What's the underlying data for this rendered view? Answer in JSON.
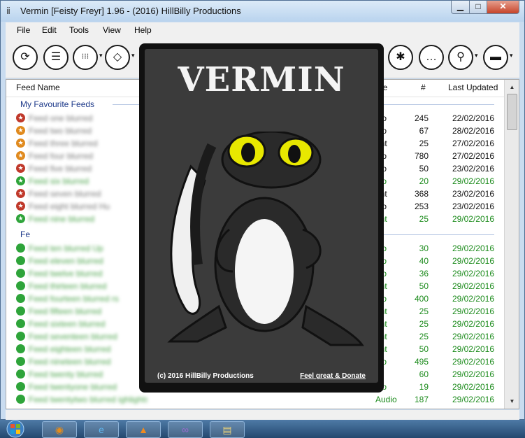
{
  "window": {
    "title": "Vermin [Feisty Freyr] 1.96 - (2016) HillBilly Productions",
    "icon": "app-icon",
    "min_glyph": "▁",
    "max_glyph": "□",
    "close_glyph": "✕"
  },
  "menu": [
    "File",
    "Edit",
    "Tools",
    "View",
    "Help"
  ],
  "toolbar": {
    "buttons": [
      {
        "name": "refresh-icon",
        "glyph": "⟳"
      },
      {
        "name": "database-icon",
        "glyph": "☰"
      },
      {
        "name": "grid-icon",
        "glyph": "⁝⁝⁝"
      },
      {
        "name": "drop-icon",
        "glyph": "◇"
      },
      {
        "name": "gear-icon",
        "glyph": "✱"
      },
      {
        "name": "chat-icon",
        "glyph": "…"
      },
      {
        "name": "search-icon",
        "glyph": "⚲"
      },
      {
        "name": "book-icon",
        "glyph": "▬"
      }
    ],
    "dropdown_glyph": "▾"
  },
  "columns": {
    "feed_name": "Feed Name",
    "type": "pe",
    "count": "#",
    "last_updated": "Last Updated"
  },
  "groups": {
    "favourites": "My Favourite Feeds",
    "second": "Fe"
  },
  "favourites_rows": [
    {
      "name": "Feed one blurred",
      "type": "dio",
      "count": "245",
      "date": "22/02/2016",
      "icon": "red",
      "green": false
    },
    {
      "name": "Feed two blurred",
      "type": "dio",
      "count": "67",
      "date": "28/02/2016",
      "icon": "orange",
      "green": false
    },
    {
      "name": "Feed three blurred",
      "type": "ent",
      "count": "25",
      "date": "27/02/2016",
      "icon": "orange",
      "green": false
    },
    {
      "name": "Feed four blurred",
      "type": "dio",
      "count": "780",
      "date": "27/02/2016",
      "icon": "orange",
      "green": false
    },
    {
      "name": "Feed five blurred",
      "type": "dio",
      "count": "50",
      "date": "23/02/2016",
      "icon": "red",
      "green": false
    },
    {
      "name": "Feed six blurred",
      "type": "dio",
      "count": "20",
      "date": "29/02/2016",
      "icon": "green",
      "green": true
    },
    {
      "name": "Feed seven blurred",
      "type": "ent",
      "count": "368",
      "date": "23/02/2016",
      "icon": "red",
      "green": false
    },
    {
      "name": "Feed eight blurred Hu",
      "type": "dio",
      "count": "253",
      "date": "23/02/2016",
      "icon": "red",
      "green": false
    },
    {
      "name": "Feed nine blurred",
      "type": "ent",
      "count": "25",
      "date": "29/02/2016",
      "icon": "green",
      "green": true
    }
  ],
  "other_rows": [
    {
      "name": "Feed ten blurred Up",
      "type": "dio",
      "count": "30",
      "date": "29/02/2016"
    },
    {
      "name": "Feed eleven blurred",
      "type": "dio",
      "count": "40",
      "date": "29/02/2016"
    },
    {
      "name": "Feed twelve blurred",
      "type": "dio",
      "count": "36",
      "date": "29/02/2016"
    },
    {
      "name": "Feed thirteen blurred",
      "type": "ent",
      "count": "50",
      "date": "29/02/2016"
    },
    {
      "name": "Feed fourteen blurred rs",
      "type": "dio",
      "count": "400",
      "date": "29/02/2016"
    },
    {
      "name": "Feed fifteen blurred",
      "type": "ent",
      "count": "25",
      "date": "29/02/2016"
    },
    {
      "name": "Feed sixteen blurred",
      "type": "ent",
      "count": "25",
      "date": "29/02/2016"
    },
    {
      "name": "Feed seventeen blurred",
      "type": "ent",
      "count": "25",
      "date": "29/02/2016"
    },
    {
      "name": "Feed eighteen blurred",
      "type": "ent",
      "count": "50",
      "date": "29/02/2016"
    },
    {
      "name": "Feed nineteen blurred",
      "type": "dio",
      "count": "495",
      "date": "29/02/2016"
    },
    {
      "name": "Feed twenty blurred",
      "type": "et",
      "count": "60",
      "date": "29/02/2016"
    },
    {
      "name": "Feed twentyone blurred",
      "type": "dio",
      "count": "19",
      "date": "29/02/2016"
    },
    {
      "name": "Feed twentytwo blurred ighlights)",
      "type": "Audio",
      "count": "187",
      "date": "29/02/2016"
    }
  ],
  "splash": {
    "title": "VERMIN",
    "copyright": "(c) 2016 HillBilly Productions",
    "donate": "Feel great & Donate"
  },
  "colors": {
    "green_text": "#1a8a1a",
    "header_blue": "#1e3a8a",
    "icon_red": "#c0392b",
    "icon_orange": "#e08a1e",
    "icon_green": "#2ea43a"
  },
  "taskbar": {
    "start_icon": "windows-start-icon",
    "apps": [
      "outlook-icon",
      "ie-icon",
      "vlc-icon",
      "explorer-icon",
      "visual-studio-icon"
    ]
  }
}
